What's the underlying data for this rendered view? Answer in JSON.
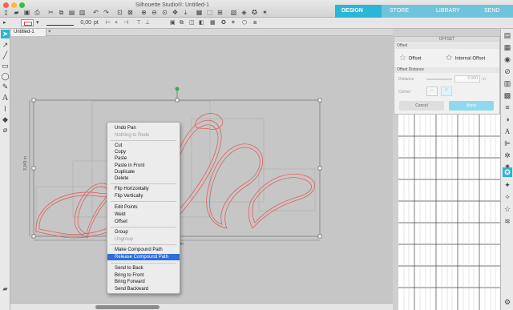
{
  "app": {
    "title": "Silhouette Studio®: Untitled-1"
  },
  "tabs": [
    {
      "label": "DESIGN",
      "active": true
    },
    {
      "label": "STORE",
      "active": false
    },
    {
      "label": "LIBRARY",
      "active": false
    },
    {
      "label": "SEND",
      "active": false
    }
  ],
  "toolbar_icons": [
    "new-document-icon",
    "open-folder-icon",
    "save-icon",
    "print-icon",
    "cut-icon",
    "copy-icon",
    "paste-icon",
    "delete-icon",
    "undo-icon",
    "redo-icon",
    "select-all-icon",
    "deselect-icon",
    "zoom-in-icon",
    "zoom-out-icon",
    "zoom-fit-icon",
    "pan-icon",
    "zoom-page-icon",
    "group-icon",
    "ungroup-icon",
    "align-icon",
    "replicate-icon",
    "transform-icon",
    "offset-icon",
    "trace-icon"
  ],
  "line": {
    "width": "0,00",
    "unit": "pt"
  },
  "document": {
    "tab_label": "Untitled-1",
    "close": "×"
  },
  "dimensions": {
    "height_label": "3,343 in",
    "width_label": "in"
  },
  "context_menu": {
    "items": [
      {
        "label": "Undo Pan",
        "enabled": true
      },
      {
        "label": "Nothing to Redo",
        "enabled": false
      },
      {
        "label": "Cut",
        "enabled": true
      },
      {
        "label": "Copy",
        "enabled": true
      },
      {
        "label": "Paste",
        "enabled": true
      },
      {
        "label": "Paste in Front",
        "enabled": true
      },
      {
        "label": "Duplicate",
        "enabled": true
      },
      {
        "label": "Delete",
        "enabled": true
      },
      {
        "label": "Flip Horizontally",
        "enabled": true
      },
      {
        "label": "Flip Vertically",
        "enabled": true
      },
      {
        "label": "Edit Points",
        "enabled": true
      },
      {
        "label": "Weld",
        "enabled": true
      },
      {
        "label": "Offset",
        "enabled": true
      },
      {
        "label": "Group",
        "enabled": true
      },
      {
        "label": "Ungroup",
        "enabled": false
      },
      {
        "label": "Make Compound Path",
        "enabled": true
      },
      {
        "label": "Release Compound Path",
        "enabled": true,
        "highlighted": true
      },
      {
        "label": "Send to Back",
        "enabled": true
      },
      {
        "label": "Bring to Front",
        "enabled": true
      },
      {
        "label": "Bring Forward",
        "enabled": true
      },
      {
        "label": "Send Backward",
        "enabled": true
      }
    ]
  },
  "offset_panel": {
    "title": "OFFSET",
    "section_offset": "Offset",
    "offset_button": "Offset",
    "internal_offset_button": "Internal Offset",
    "section_distance": "Offset Distance",
    "distance_label": "Distance",
    "distance_value": "0,000",
    "distance_unit": "in",
    "corner_label": "Corner",
    "cancel_label": "Cancel",
    "apply_label": "Apply"
  },
  "colors": {
    "accent": "#2bb5d6",
    "accent_light": "#6fc4db",
    "menu_highlight": "#2e6fd6",
    "shape_stroke": "#e06060",
    "canvas": "#c6c6c6"
  }
}
